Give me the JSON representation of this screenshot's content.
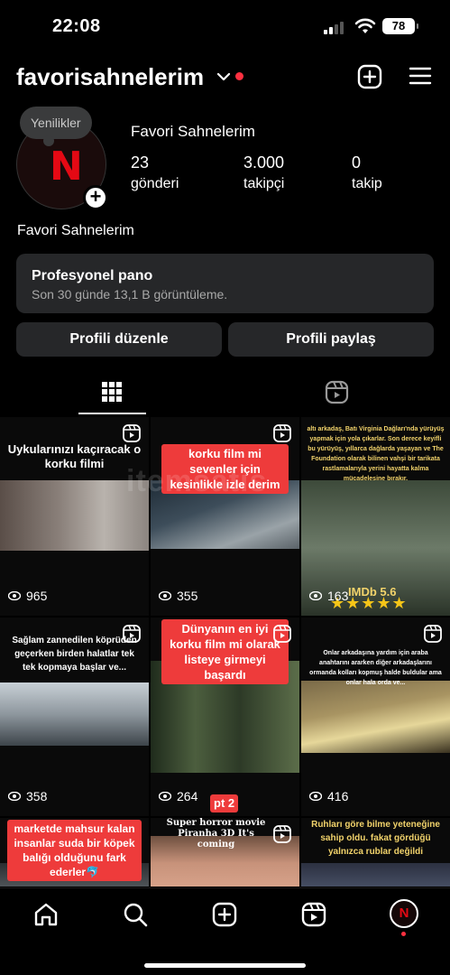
{
  "status_bar": {
    "time": "22:08",
    "battery": "78"
  },
  "header": {
    "username": "favorisahnelerim"
  },
  "profile": {
    "note_bubble": "Yenilikler",
    "avatar_letter": "N",
    "display_name": "Favori Sahnelerim",
    "stats": [
      {
        "value": "23",
        "label": "gönderi"
      },
      {
        "value": "3.000",
        "label": "takipçi"
      },
      {
        "value": "0",
        "label": "takip"
      }
    ],
    "bio_name": "Favori Sahnelerim"
  },
  "dashboard": {
    "title": "Profesyonel pano",
    "subtitle": "Son 30 günde 13,1 B görüntüleme."
  },
  "buttons": {
    "edit": "Profili düzenle",
    "share": "Profili paylaş"
  },
  "grid": {
    "posts": [
      {
        "caption": "Uykularınızı kaçıracak o korku filmi",
        "views": "965"
      },
      {
        "caption": "korku film mi sevenler için kesinlikle izle derim",
        "views": "355"
      },
      {
        "caption": "altı arkadaş, Batı Virginia Dağları'nda yürüyüş yapmak için yola çıkarlar. Son derece keyifli bu yürüyüş, yıllarca dağlarda yaşayan ve The Foundation olarak bilinen vahşi bir tarikata rastlamalarıyla yerini hayatta kalma mücadelesine bırakır.",
        "views": "163",
        "rating": "IMDb 5.6",
        "stars": "★★★★★"
      },
      {
        "caption": "Sağlam zannedilen köprüden geçerken birden halatlar tek tek kopmaya başlar ve...",
        "views": "358"
      },
      {
        "caption": "Dünyanın en iyi korku film mi olarak listeye girmeyi başardı",
        "views": "264",
        "badge": "pt 2"
      },
      {
        "caption": "Onlar arkadaşına yardım için araba anahtarını ararken diğer arkadaşlarını ormanda kolları kopmuş halde buldular ama onlar hala orda ve...",
        "views": "416"
      },
      {
        "caption": "marketde mahsur kalan insanlar suda bir köpek balığı olduğunu fark ederler🐬"
      },
      {
        "caption": "Super horror movie Piranha 3D It's coming"
      },
      {
        "caption": "Ruhları göre bilme yeteneğine sahip oldu. fakat gördüğü yalnızca rublar değildi"
      }
    ]
  },
  "watermark": "itemsatis",
  "colors": {
    "accent_red": "#ff3040",
    "netflix_red": "#e50914",
    "card_bg": "#262729",
    "caption_red": "#ee3b3b"
  }
}
